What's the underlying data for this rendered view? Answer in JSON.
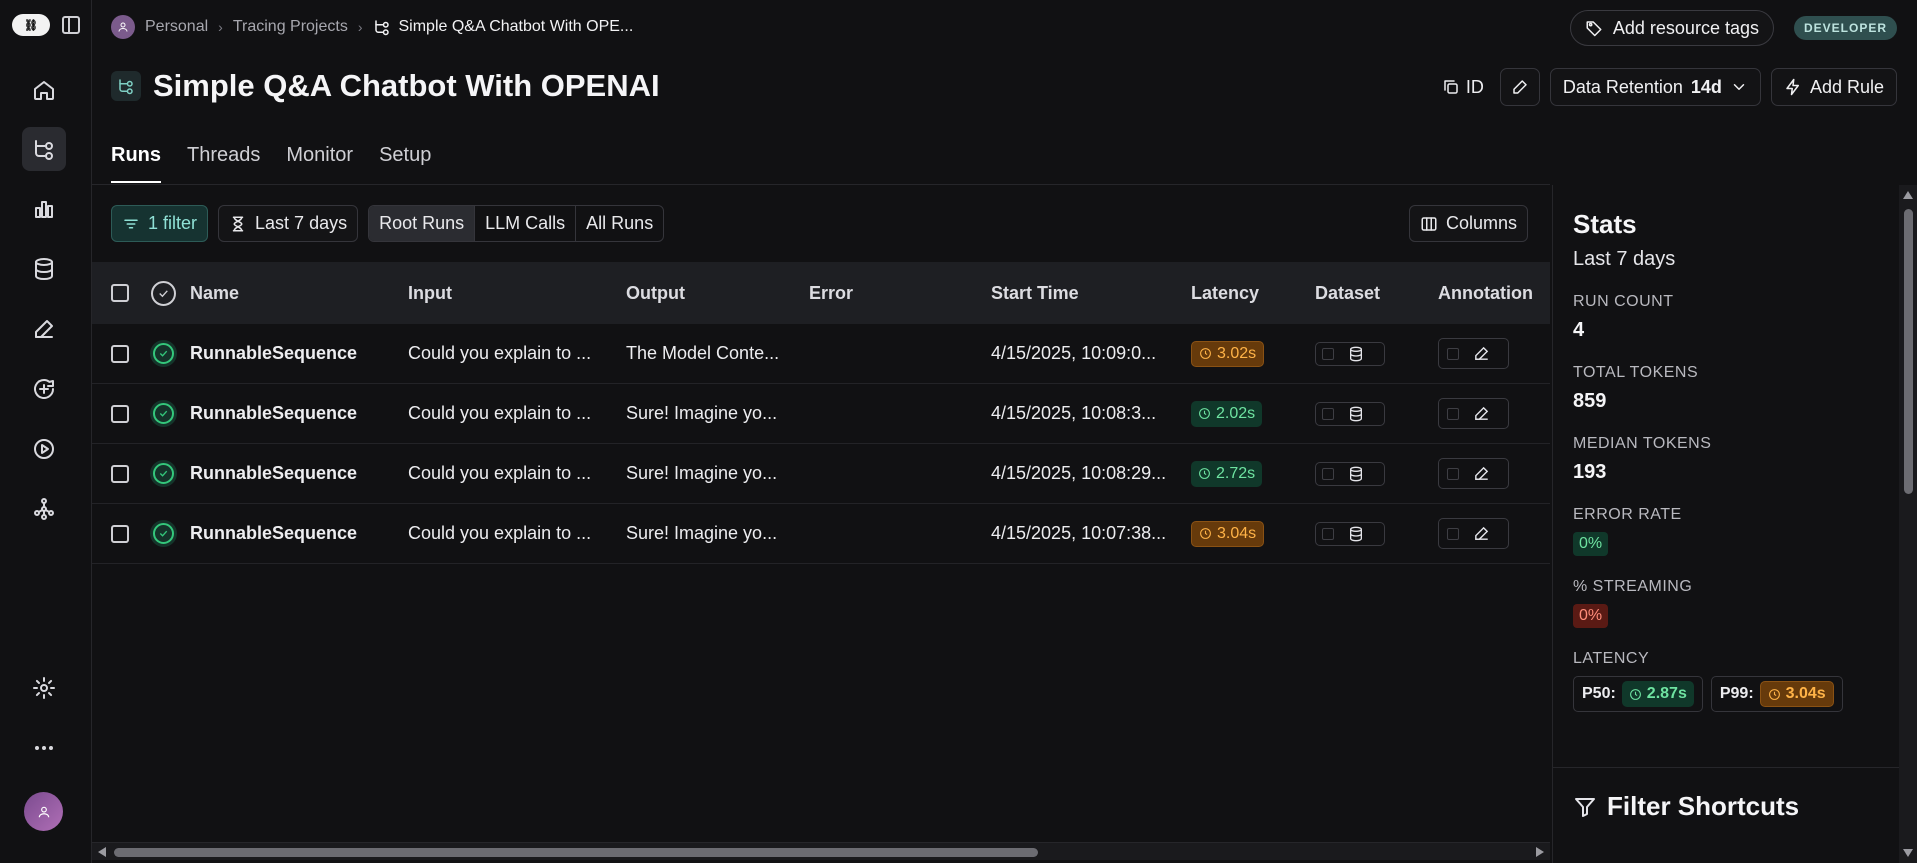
{
  "breadcrumb": {
    "workspace": "Personal",
    "section": "Tracing Projects",
    "current": "Simple Q&A Chatbot With OPE..."
  },
  "header": {
    "add_tags": "Add resource tags",
    "badge": "DEVELOPER",
    "title": "Simple Q&A Chatbot With OPENAI",
    "id_label": "ID",
    "retention_label": "Data Retention",
    "retention_value": "14d",
    "add_rule": "Add Rule"
  },
  "tabs": [
    "Runs",
    "Threads",
    "Monitor",
    "Setup"
  ],
  "filters": {
    "filter_count": "1 filter",
    "range": "Last 7 days",
    "segments": [
      "Root Runs",
      "LLM Calls",
      "All Runs"
    ],
    "columns": "Columns"
  },
  "table": {
    "headers": [
      "Name",
      "Input",
      "Output",
      "Error",
      "Start Time",
      "Latency",
      "Dataset",
      "Annotation"
    ],
    "rows": [
      {
        "name": "RunnableSequence",
        "input": "Could you explain to ...",
        "output": "The Model Conte...",
        "error": "",
        "start": "4/15/2025, 10:09:0...",
        "latency": "3.02s",
        "latency_level": "orange"
      },
      {
        "name": "RunnableSequence",
        "input": "Could you explain to ...",
        "output": "Sure! Imagine yo...",
        "error": "",
        "start": "4/15/2025, 10:08:3...",
        "latency": "2.02s",
        "latency_level": "green"
      },
      {
        "name": "RunnableSequence",
        "input": "Could you explain to ...",
        "output": "Sure! Imagine yo...",
        "error": "",
        "start": "4/15/2025, 10:08:29...",
        "latency": "2.72s",
        "latency_level": "green"
      },
      {
        "name": "RunnableSequence",
        "input": "Could you explain to ...",
        "output": "Sure! Imagine yo...",
        "error": "",
        "start": "4/15/2025, 10:07:38...",
        "latency": "3.04s",
        "latency_level": "orange"
      }
    ]
  },
  "stats": {
    "title": "Stats",
    "range": "Last 7 days",
    "run_count_label": "RUN COUNT",
    "run_count": "4",
    "total_tokens_label": "TOTAL TOKENS",
    "total_tokens": "859",
    "median_tokens_label": "MEDIAN TOKENS",
    "median_tokens": "193",
    "error_rate_label": "ERROR RATE",
    "error_rate": "0%",
    "streaming_label": "% STREAMING",
    "streaming": "0%",
    "latency_label": "LATENCY",
    "p50_label": "P50:",
    "p50": "2.87s",
    "p99_label": "P99:",
    "p99": "3.04s",
    "filter_shortcuts": "Filter Shortcuts"
  },
  "colors": {
    "accent_teal": "#8fe0d5",
    "latency_green": "#6ee3a1",
    "latency_orange": "#ffb347",
    "error_red": "#ff8c7a"
  }
}
